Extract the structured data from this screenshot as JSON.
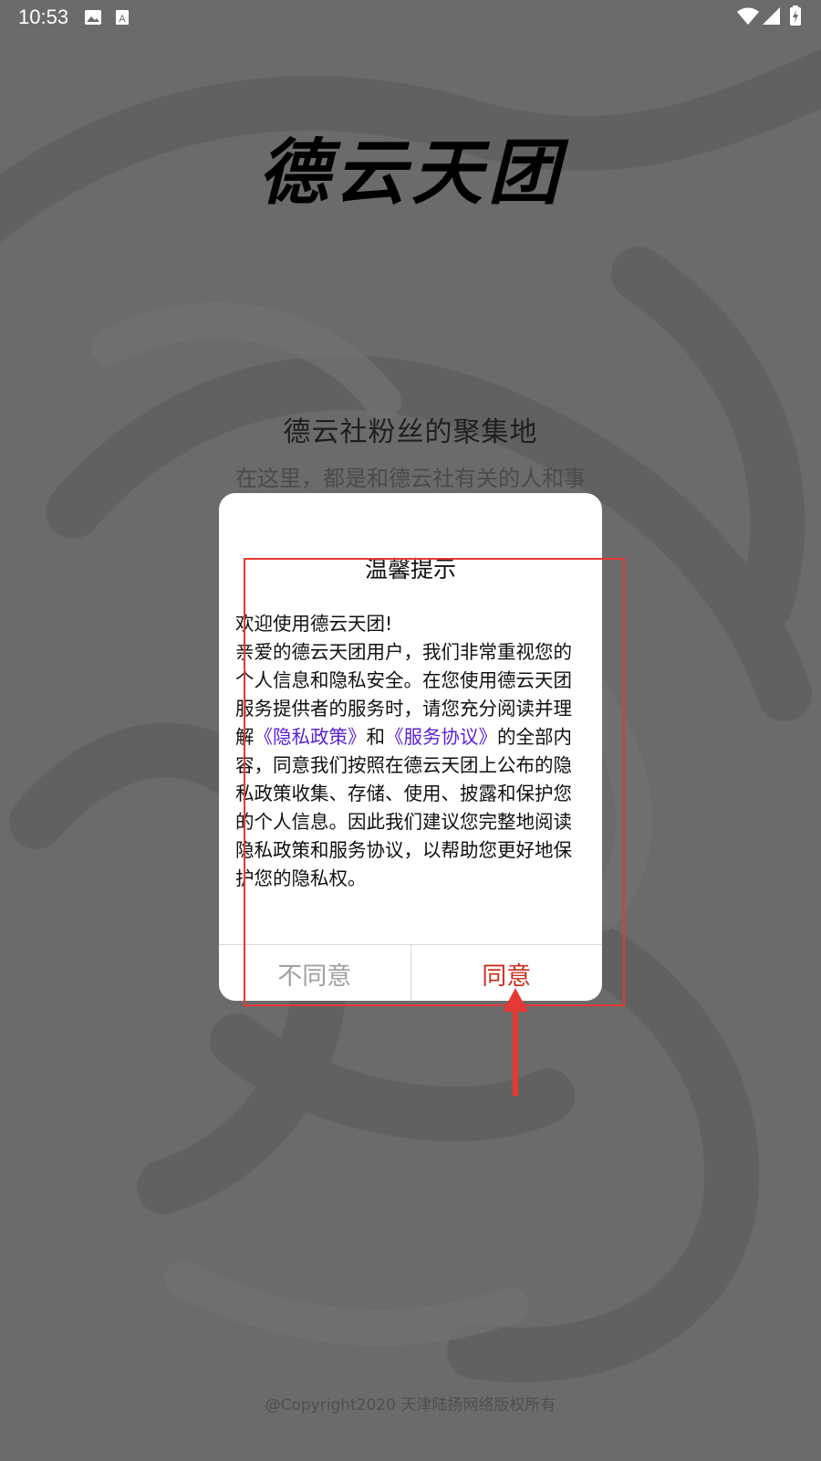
{
  "status_bar": {
    "time": "10:53",
    "icons": [
      "image-icon",
      "font-icon",
      "wifi-icon",
      "signal-icon",
      "battery-icon"
    ]
  },
  "splash": {
    "logo_text": "德云天团",
    "tagline": "德云社粉丝的聚集地",
    "subtagline": "在这里，都是和德云社有关的人和事",
    "copyright": "@Copyright2020 天津陆扬网络版权所有"
  },
  "dialog": {
    "title": "温馨提示",
    "greeting": "欢迎使用德云天团!",
    "body_part1": "亲爱的德云天团用户，我们非常重视您的个人信息和隐私安全。在您使用德云天团服务提供者的服务时，请您充分阅读并理解",
    "privacy_link": "《隐私政策》",
    "and_text": "和",
    "service_link": "《服务协议》",
    "body_part2": "的全部内容，同意我们按照在德云天团上公布的隐私政策收集、存储、使用、披露和保护您的个人信息。因此我们建议您完整地阅读隐私政策和服务协议，以帮助您更好地保护您的隐私权。",
    "disagree_label": "不同意",
    "agree_label": "同意"
  },
  "colors": {
    "overlay_bg": "#6b6b6b",
    "link": "#5b21d6",
    "agree": "#c8311e",
    "disagree": "#a0a0a0",
    "annotation": "#e53935"
  }
}
